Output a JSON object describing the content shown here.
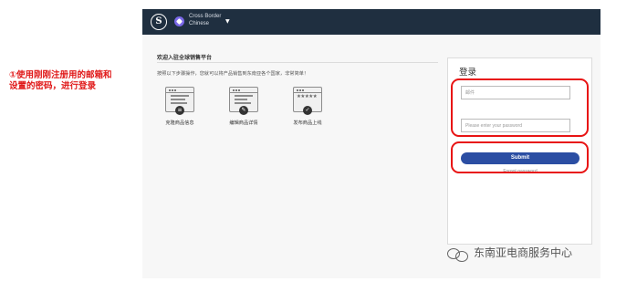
{
  "annotation": {
    "text": "①使用刚刚注册用的邮箱和设置的密码，进行登录"
  },
  "topbar": {
    "logo_letter": "S",
    "site_name_line1": "Cross Border",
    "site_name_line2": "Chinese",
    "caret": "▼"
  },
  "main": {
    "welcome": "欢迎入驻全球销售平台",
    "intro": "按照以下步骤操作，您就可以将产品销售到东南亚各个国家，非常简单！",
    "steps": [
      {
        "label": "克隆商品信息"
      },
      {
        "label": "编辑商品详情"
      },
      {
        "label": "发布商品上线"
      }
    ]
  },
  "login": {
    "title": "登录",
    "email_placeholder": "邮件",
    "password_placeholder": "Please enter your password",
    "submit_label": "Submit",
    "forgot_label": "Forgot password"
  },
  "watermark": {
    "text": "东南亚电商服务中心"
  },
  "colors": {
    "highlight": "#e81414",
    "topbar": "#1f2f40",
    "primary": "#2b4ea3",
    "annotation": "#e01818"
  }
}
